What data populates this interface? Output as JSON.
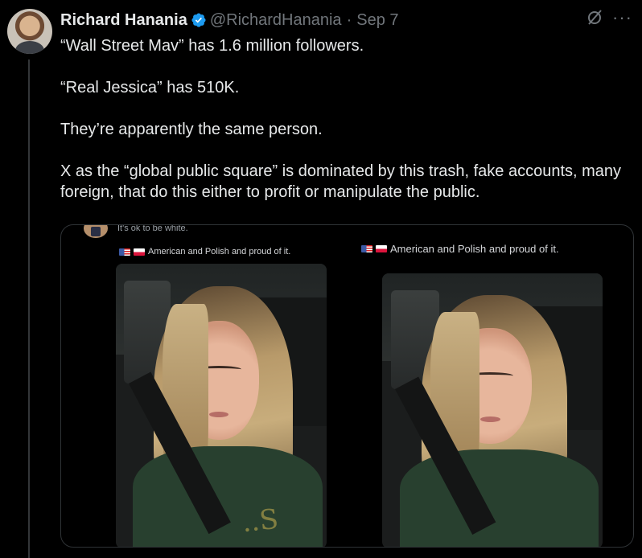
{
  "author": {
    "name": "Richard Hanania",
    "handle": "@RichardHanania",
    "separator": "·",
    "date": "Sep 7",
    "verified_color": "#1d9bf0"
  },
  "actions": {
    "grok_icon": "grok-icon",
    "more_icon": "more-icon",
    "more_label": "···"
  },
  "tweet": {
    "paragraphs": [
      "“Wall Street Mav” has 1.6 million followers.",
      "“Real Jessica” has 510K.",
      "They’re apparently the same person.",
      "X as the “global public square” is dominated by this trash, fake accounts, many foreign, that do this either to profit or manipulate the public."
    ]
  },
  "media": {
    "left": {
      "subcaption": "It's ok to be white.",
      "caption": "American and Polish and proud of it."
    },
    "right": {
      "caption": "American and Polish and proud of it."
    },
    "sweater_print": "..S"
  },
  "colors": {
    "background": "#000000",
    "text": "#e7e9ea",
    "muted": "#71767b",
    "border": "#2f3336"
  }
}
